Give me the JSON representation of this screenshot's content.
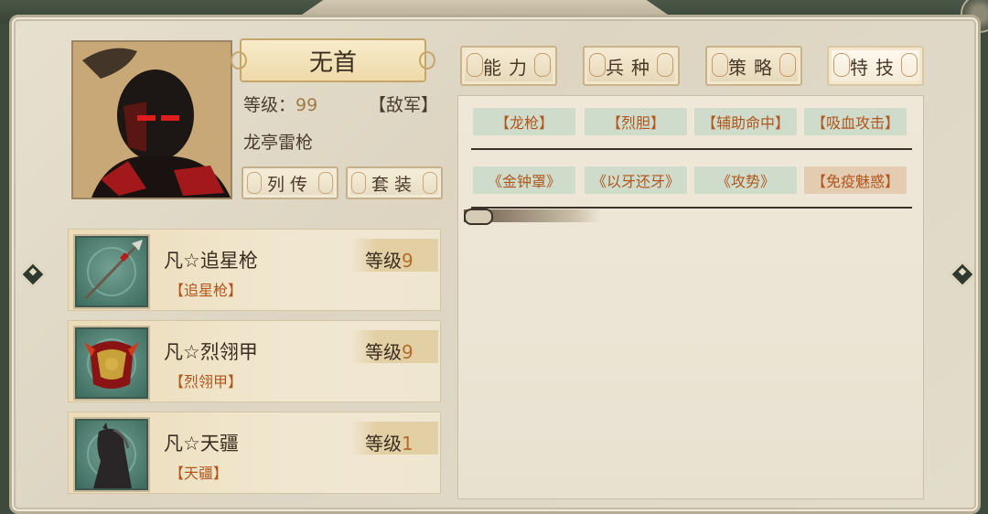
{
  "character": {
    "name": "无首",
    "level_label": "等级：",
    "level_value": "99",
    "faction": "【敌军】",
    "title": "龙亭雷枪"
  },
  "buttons": {
    "biography": "列传",
    "suit": "套装"
  },
  "tabs": [
    {
      "label": "能力",
      "active": false
    },
    {
      "label": "兵种",
      "active": false
    },
    {
      "label": "策略",
      "active": false
    },
    {
      "label": "特技",
      "active": true
    }
  ],
  "skills_row1": [
    "【龙枪】",
    "【烈胆】",
    "【辅助命中】",
    "【吸血攻击】"
  ],
  "skills_row2": [
    "《金钟罩》",
    "《以牙还牙》",
    "《攻势》",
    "【免疫魅惑】"
  ],
  "equipment": [
    {
      "name": "凡☆追星枪",
      "level_label": "等级",
      "level": "9",
      "sub": "【追星枪】",
      "icon": "spear-icon"
    },
    {
      "name": "凡☆烈翎甲",
      "level_label": "等级",
      "level": "9",
      "sub": "【烈翎甲】",
      "icon": "armor-icon"
    },
    {
      "name": "凡☆天疆",
      "level_label": "等级",
      "level": "1",
      "sub": "【天疆】",
      "icon": "horse-icon"
    }
  ],
  "colors": {
    "panel_bg": "#e3dccb",
    "skill_green": "#cfdccb",
    "skill_tan": "#e3ccb1",
    "accent_orange": "#b0561d"
  }
}
